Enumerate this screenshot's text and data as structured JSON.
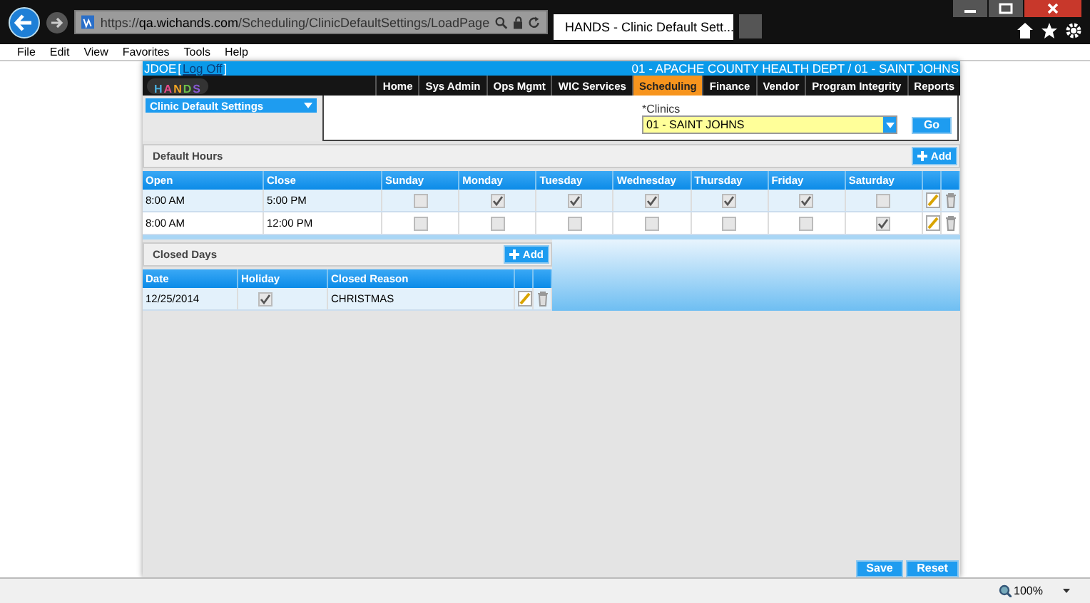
{
  "browser": {
    "url_prefix": "https://",
    "url_host": "qa.wichands.com",
    "url_path": "/Scheduling/ClinicDefaultSettings/LoadPage",
    "tab_title": "HANDS - Clinic Default Sett...",
    "menu": [
      "File",
      "Edit",
      "View",
      "Favorites",
      "Tools",
      "Help"
    ],
    "zoom": "100%"
  },
  "app": {
    "user": "JDOE",
    "bracket_open": "[",
    "logoff": "Log Off",
    "bracket_close": "]",
    "location": "01 - APACHE COUNTY HEALTH DEPT / 01 - SAINT JOHNS",
    "logo": "HANDS",
    "nav": [
      {
        "label": "Home",
        "selected": false
      },
      {
        "label": "Sys Admin",
        "selected": false
      },
      {
        "label": "Ops Mgmt",
        "selected": false
      },
      {
        "label": "WIC Services",
        "selected": false
      },
      {
        "label": "Scheduling",
        "selected": true
      },
      {
        "label": "Finance",
        "selected": false
      },
      {
        "label": "Vendor",
        "selected": false
      },
      {
        "label": "Program Integrity",
        "selected": false
      },
      {
        "label": "Reports",
        "selected": false
      }
    ],
    "page_menu": "Clinic Default Settings",
    "clinics": {
      "label": "*Clinics",
      "value": "01 - SAINT JOHNS",
      "button": "Go"
    },
    "default_hours": {
      "title": "Default Hours",
      "add": "Add",
      "columns": [
        "Open",
        "Close",
        "Sunday",
        "Monday",
        "Tuesday",
        "Wednesday",
        "Thursday",
        "Friday",
        "Saturday"
      ],
      "rows": [
        {
          "open": "8:00 AM",
          "close": "5:00 PM",
          "days": [
            false,
            true,
            true,
            true,
            true,
            true,
            false
          ]
        },
        {
          "open": "8:00 AM",
          "close": "12:00 PM",
          "days": [
            false,
            false,
            false,
            false,
            false,
            false,
            true
          ]
        }
      ]
    },
    "closed_days": {
      "title": "Closed Days",
      "add": "Add",
      "columns": [
        "Date",
        "Holiday",
        "Closed Reason"
      ],
      "rows": [
        {
          "date": "12/25/2014",
          "holiday": true,
          "reason": "CHRISTMAS"
        }
      ]
    },
    "buttons": [
      "Save",
      "Reset"
    ]
  }
}
